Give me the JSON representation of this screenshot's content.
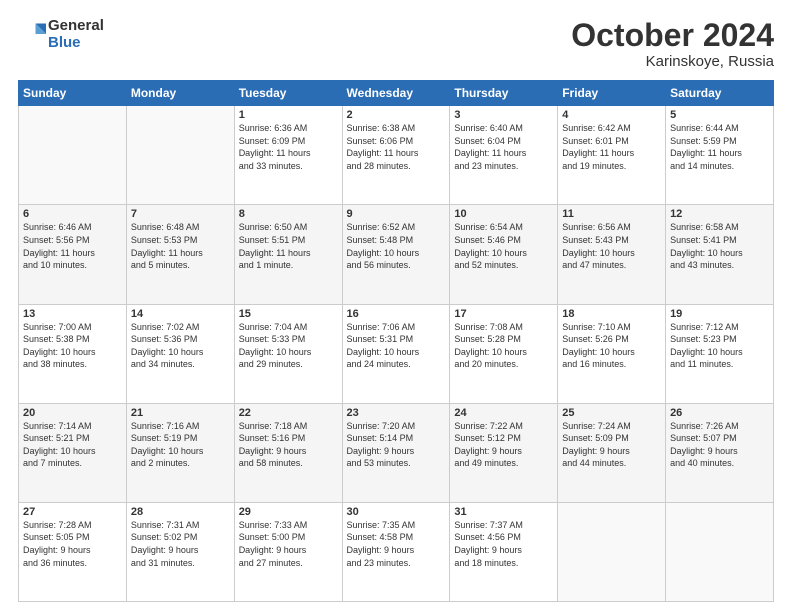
{
  "logo": {
    "general": "General",
    "blue": "Blue"
  },
  "title": "October 2024",
  "location": "Karinskoye, Russia",
  "days_header": [
    "Sunday",
    "Monday",
    "Tuesday",
    "Wednesday",
    "Thursday",
    "Friday",
    "Saturday"
  ],
  "weeks": [
    [
      {
        "day": "",
        "info": ""
      },
      {
        "day": "",
        "info": ""
      },
      {
        "day": "1",
        "info": "Sunrise: 6:36 AM\nSunset: 6:09 PM\nDaylight: 11 hours\nand 33 minutes."
      },
      {
        "day": "2",
        "info": "Sunrise: 6:38 AM\nSunset: 6:06 PM\nDaylight: 11 hours\nand 28 minutes."
      },
      {
        "day": "3",
        "info": "Sunrise: 6:40 AM\nSunset: 6:04 PM\nDaylight: 11 hours\nand 23 minutes."
      },
      {
        "day": "4",
        "info": "Sunrise: 6:42 AM\nSunset: 6:01 PM\nDaylight: 11 hours\nand 19 minutes."
      },
      {
        "day": "5",
        "info": "Sunrise: 6:44 AM\nSunset: 5:59 PM\nDaylight: 11 hours\nand 14 minutes."
      }
    ],
    [
      {
        "day": "6",
        "info": "Sunrise: 6:46 AM\nSunset: 5:56 PM\nDaylight: 11 hours\nand 10 minutes."
      },
      {
        "day": "7",
        "info": "Sunrise: 6:48 AM\nSunset: 5:53 PM\nDaylight: 11 hours\nand 5 minutes."
      },
      {
        "day": "8",
        "info": "Sunrise: 6:50 AM\nSunset: 5:51 PM\nDaylight: 11 hours\nand 1 minute."
      },
      {
        "day": "9",
        "info": "Sunrise: 6:52 AM\nSunset: 5:48 PM\nDaylight: 10 hours\nand 56 minutes."
      },
      {
        "day": "10",
        "info": "Sunrise: 6:54 AM\nSunset: 5:46 PM\nDaylight: 10 hours\nand 52 minutes."
      },
      {
        "day": "11",
        "info": "Sunrise: 6:56 AM\nSunset: 5:43 PM\nDaylight: 10 hours\nand 47 minutes."
      },
      {
        "day": "12",
        "info": "Sunrise: 6:58 AM\nSunset: 5:41 PM\nDaylight: 10 hours\nand 43 minutes."
      }
    ],
    [
      {
        "day": "13",
        "info": "Sunrise: 7:00 AM\nSunset: 5:38 PM\nDaylight: 10 hours\nand 38 minutes."
      },
      {
        "day": "14",
        "info": "Sunrise: 7:02 AM\nSunset: 5:36 PM\nDaylight: 10 hours\nand 34 minutes."
      },
      {
        "day": "15",
        "info": "Sunrise: 7:04 AM\nSunset: 5:33 PM\nDaylight: 10 hours\nand 29 minutes."
      },
      {
        "day": "16",
        "info": "Sunrise: 7:06 AM\nSunset: 5:31 PM\nDaylight: 10 hours\nand 24 minutes."
      },
      {
        "day": "17",
        "info": "Sunrise: 7:08 AM\nSunset: 5:28 PM\nDaylight: 10 hours\nand 20 minutes."
      },
      {
        "day": "18",
        "info": "Sunrise: 7:10 AM\nSunset: 5:26 PM\nDaylight: 10 hours\nand 16 minutes."
      },
      {
        "day": "19",
        "info": "Sunrise: 7:12 AM\nSunset: 5:23 PM\nDaylight: 10 hours\nand 11 minutes."
      }
    ],
    [
      {
        "day": "20",
        "info": "Sunrise: 7:14 AM\nSunset: 5:21 PM\nDaylight: 10 hours\nand 7 minutes."
      },
      {
        "day": "21",
        "info": "Sunrise: 7:16 AM\nSunset: 5:19 PM\nDaylight: 10 hours\nand 2 minutes."
      },
      {
        "day": "22",
        "info": "Sunrise: 7:18 AM\nSunset: 5:16 PM\nDaylight: 9 hours\nand 58 minutes."
      },
      {
        "day": "23",
        "info": "Sunrise: 7:20 AM\nSunset: 5:14 PM\nDaylight: 9 hours\nand 53 minutes."
      },
      {
        "day": "24",
        "info": "Sunrise: 7:22 AM\nSunset: 5:12 PM\nDaylight: 9 hours\nand 49 minutes."
      },
      {
        "day": "25",
        "info": "Sunrise: 7:24 AM\nSunset: 5:09 PM\nDaylight: 9 hours\nand 44 minutes."
      },
      {
        "day": "26",
        "info": "Sunrise: 7:26 AM\nSunset: 5:07 PM\nDaylight: 9 hours\nand 40 minutes."
      }
    ],
    [
      {
        "day": "27",
        "info": "Sunrise: 7:28 AM\nSunset: 5:05 PM\nDaylight: 9 hours\nand 36 minutes."
      },
      {
        "day": "28",
        "info": "Sunrise: 7:31 AM\nSunset: 5:02 PM\nDaylight: 9 hours\nand 31 minutes."
      },
      {
        "day": "29",
        "info": "Sunrise: 7:33 AM\nSunset: 5:00 PM\nDaylight: 9 hours\nand 27 minutes."
      },
      {
        "day": "30",
        "info": "Sunrise: 7:35 AM\nSunset: 4:58 PM\nDaylight: 9 hours\nand 23 minutes."
      },
      {
        "day": "31",
        "info": "Sunrise: 7:37 AM\nSunset: 4:56 PM\nDaylight: 9 hours\nand 18 minutes."
      },
      {
        "day": "",
        "info": ""
      },
      {
        "day": "",
        "info": ""
      }
    ]
  ]
}
